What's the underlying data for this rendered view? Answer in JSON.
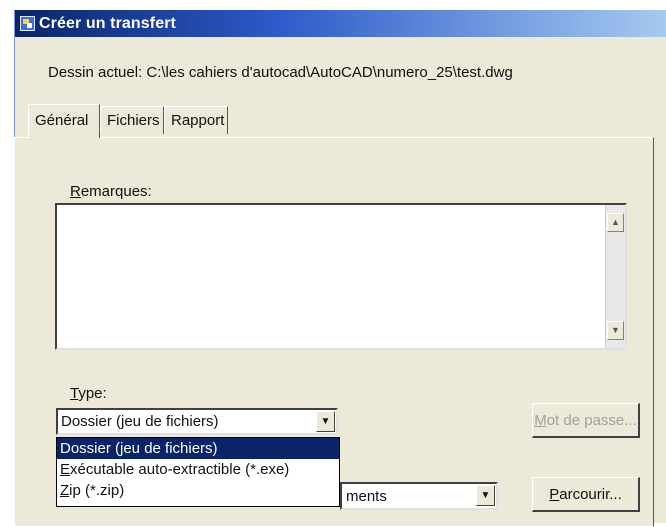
{
  "window": {
    "title": "Créer un transfert"
  },
  "drawing": {
    "label": "Dessin actuel:",
    "path": "C:\\les cahiers d'autocad\\AutoCAD\\numero_25\\test.dwg"
  },
  "tabs": [
    {
      "label": "Général",
      "active": true
    },
    {
      "label": "Fichiers",
      "active": false
    },
    {
      "label": "Rapport",
      "active": false
    }
  ],
  "remarks": {
    "label_accel": "R",
    "label_rest": "emarques:",
    "value": ""
  },
  "type": {
    "label_accel": "T",
    "label_rest": "ype:",
    "selected": "Dossier (jeu de fichiers)",
    "options": [
      {
        "accel": "",
        "rest": "Dossier (jeu de fichiers)"
      },
      {
        "accel": "E",
        "rest": "xécutable auto-extractible (*.exe)"
      },
      {
        "accel": "Z",
        "rest": "ip (*.zip)"
      }
    ]
  },
  "folder": {
    "value_visible": "ments"
  },
  "buttons": {
    "password_accel": "M",
    "password_rest": "ot de passe...",
    "browse_accel": "P",
    "browse_rest": "arcourir..."
  },
  "icons": {
    "title_icon": "transmit-icon",
    "scroll_up": "arrow-up-icon",
    "scroll_down": "arrow-down-icon",
    "dropdown": "chevron-down-icon"
  },
  "colors": {
    "selection": "#0a246a",
    "titlebar": "#0a246a",
    "face": "#ece9d8"
  }
}
